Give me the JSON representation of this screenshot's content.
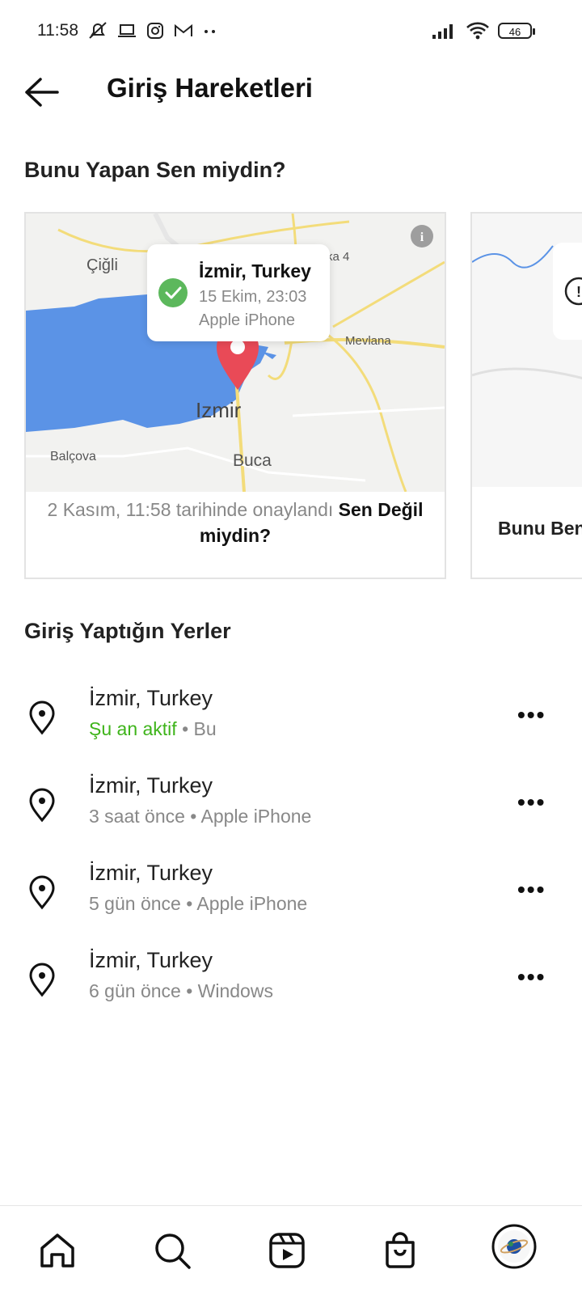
{
  "status_bar": {
    "time": "11:58",
    "battery": "46"
  },
  "header": {
    "title": "Giriş Hareketleri"
  },
  "sections": {
    "was_it_you": "Bunu Yapan Sen miydin?",
    "login_places": "Giriş Yaptığın Yerler"
  },
  "card": {
    "popup_location": "İzmir, Turkey",
    "popup_date": "15 Ekim, 23:03",
    "popup_device": "Apple iPhone",
    "map_labels": [
      "Çiğli",
      "ka 4",
      "Mevlana",
      "Izmir",
      "Balçova",
      "Buca"
    ],
    "footer_text": "2 Kasım, 11:58 tarihinde onaylandı",
    "footer_link": "Sen Değil miydin?"
  },
  "card2": {
    "text": "Bunu Ben"
  },
  "logins": [
    {
      "location": "İzmir, Turkey",
      "status": "Şu an aktif",
      "detail": "Bu"
    },
    {
      "location": "İzmir, Turkey",
      "status": "",
      "detail": "3 saat önce • Apple iPhone"
    },
    {
      "location": "İzmir, Turkey",
      "status": "",
      "detail": "5 gün önce • Apple iPhone"
    },
    {
      "location": "İzmir, Turkey",
      "status": "",
      "detail": "6 gün önce • Windows"
    }
  ],
  "colors": {
    "active": "#3eb41a",
    "pin": "#e94a57",
    "water": "#5b93e6",
    "check": "#5cb85c"
  },
  "nav": [
    "home-icon",
    "search-icon",
    "reels-icon",
    "shop-icon",
    "profile-avatar"
  ]
}
